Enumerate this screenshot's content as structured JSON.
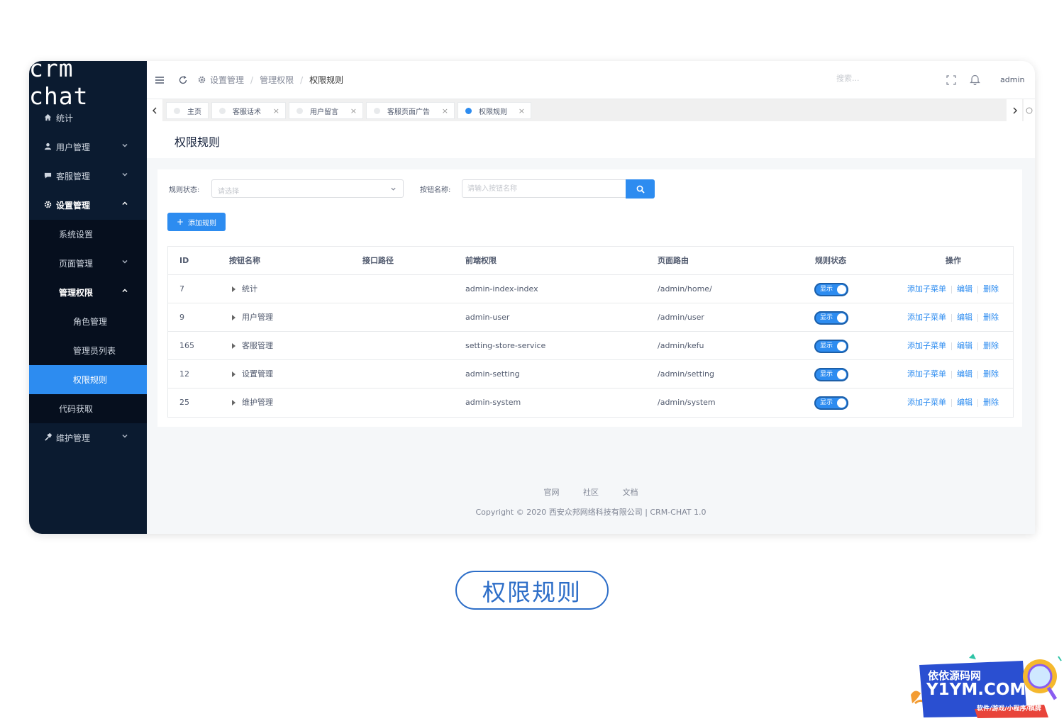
{
  "logo": "crm chat",
  "sidebar": {
    "items": [
      {
        "label": "统计",
        "icon": "home-icon"
      },
      {
        "label": "用户管理",
        "icon": "user-icon"
      },
      {
        "label": "客服管理",
        "icon": "chat-icon"
      },
      {
        "label": "设置管理",
        "icon": "gear-icon"
      },
      {
        "label": "系统设置"
      },
      {
        "label": "页面管理"
      },
      {
        "label": "管理权限"
      },
      {
        "label": "角色管理"
      },
      {
        "label": "管理员列表"
      },
      {
        "label": "权限规则"
      },
      {
        "label": "代码获取"
      },
      {
        "label": "维护管理",
        "icon": "wrench-icon"
      }
    ]
  },
  "header": {
    "breadcrumb": [
      "设置管理",
      "管理权限",
      "权限规则"
    ],
    "search_placeholder": "搜索...",
    "user": "admin"
  },
  "tabs": [
    {
      "label": "主页"
    },
    {
      "label": "客服话术"
    },
    {
      "label": "用户留言"
    },
    {
      "label": "客服页面广告"
    },
    {
      "label": "权限规则"
    }
  ],
  "page_title": "权限规则",
  "filters": {
    "status_label": "规则状态:",
    "status_placeholder": "请选择",
    "name_label": "按钮名称:",
    "name_placeholder": "请输入按钮名称"
  },
  "add_button": "添加规则",
  "table": {
    "headers": [
      "ID",
      "按钮名称",
      "接口路径",
      "前端权限",
      "页面路由",
      "规则状态",
      "操作"
    ],
    "rows": [
      {
        "id": "7",
        "name": "统计",
        "api": "",
        "fe": "admin-index-index",
        "route": "/admin/home/",
        "status": "显示"
      },
      {
        "id": "9",
        "name": "用户管理",
        "api": "",
        "fe": "admin-user",
        "route": "/admin/user",
        "status": "显示"
      },
      {
        "id": "165",
        "name": "客服管理",
        "api": "",
        "fe": "setting-store-service",
        "route": "/admin/kefu",
        "status": "显示"
      },
      {
        "id": "12",
        "name": "设置管理",
        "api": "",
        "fe": "admin-setting",
        "route": "/admin/setting",
        "status": "显示"
      },
      {
        "id": "25",
        "name": "维护管理",
        "api": "",
        "fe": "admin-system",
        "route": "/admin/system",
        "status": "显示"
      }
    ],
    "actions": {
      "add_sub": "添加子菜单",
      "edit": "编辑",
      "delete": "删除"
    }
  },
  "footer": {
    "links": [
      "官网",
      "社区",
      "文档"
    ],
    "copyright": "Copyright © 2020 西安众邦网络科技有限公司 | CRM-CHAT 1.0"
  },
  "caption": "权限规则",
  "watermark": {
    "line1": "依依源码网",
    "line2": "Y1YM.COM",
    "line3": "软件/游戏/小程序/棋牌"
  },
  "colors": {
    "primary": "#2d8cf0",
    "sidebar": "#0b1b30",
    "caption": "#2d6ec8"
  }
}
